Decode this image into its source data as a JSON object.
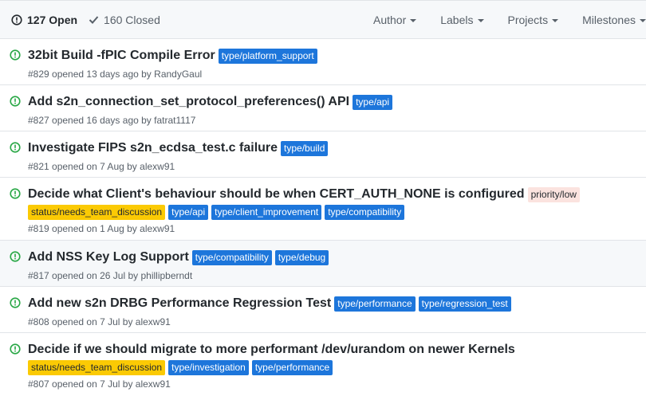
{
  "header": {
    "open_label": "127 Open",
    "closed_label": "160 Closed",
    "filters": [
      "Author",
      "Labels",
      "Projects",
      "Milestones"
    ]
  },
  "colors": {
    "open_icon": "#28a745",
    "type_label": "#1d76db",
    "status_label": "#fbca04",
    "priority_label": "#fbe3df"
  },
  "issues": [
    {
      "title": "32bit Build -fPIC Compile Error",
      "labels": [
        "type/platform_support"
      ],
      "meta_prefix": "#829 opened 13 days ago by",
      "author": "RandyGaul"
    },
    {
      "title": "Add s2n_connection_set_protocol_preferences() API",
      "labels": [
        "type/api"
      ],
      "meta_prefix": "#827 opened 16 days ago by",
      "author": "fatrat1117"
    },
    {
      "title": "Investigate FIPS s2n_ecdsa_test.c failure",
      "labels": [
        "type/build"
      ],
      "meta_prefix": "#821 opened on 7 Aug by",
      "author": "alexw91"
    },
    {
      "title": "Decide what Client's behaviour should be when CERT_AUTH_NONE is configured",
      "labels": [
        "priority/low",
        "status/needs_team_discussion",
        "type/api",
        "type/client_improvement",
        "type/compatibility"
      ],
      "meta_prefix": "#819 opened on 1 Aug by",
      "author": "alexw91"
    },
    {
      "title": "Add NSS Key Log Support",
      "labels": [
        "type/compatibility",
        "type/debug"
      ],
      "meta_prefix": "#817 opened on 26 Jul by",
      "author": "phillipberndt"
    },
    {
      "title": "Add new s2n DRBG Performance Regression Test",
      "labels": [
        "type/performance",
        "type/regression_test"
      ],
      "meta_prefix": "#808 opened on 7 Jul by",
      "author": "alexw91"
    },
    {
      "title": "Decide if we should migrate to more performant /dev/urandom on newer Kernels",
      "labels": [
        "status/needs_team_discussion",
        "type/investigation",
        "type/performance"
      ],
      "meta_prefix": "#807 opened on 7 Jul by",
      "author": "alexw91"
    }
  ]
}
